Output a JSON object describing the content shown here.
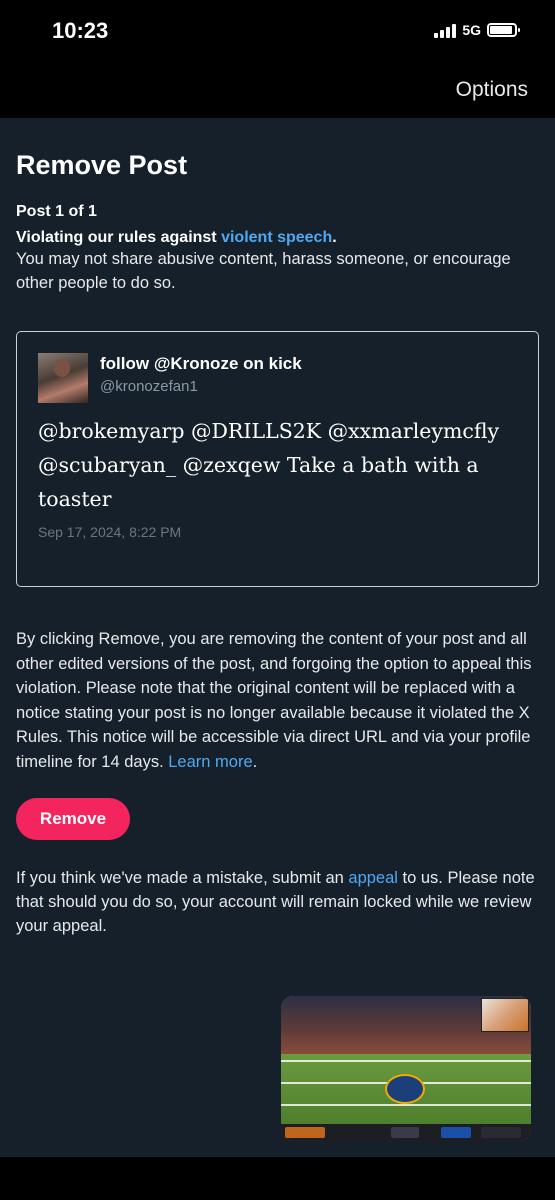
{
  "status_bar": {
    "time": "10:23",
    "network": "5G",
    "icons": [
      "cellular-signal-icon",
      "battery-icon"
    ]
  },
  "nav": {
    "options_label": "Options"
  },
  "page": {
    "title": "Remove Post",
    "post_count": "Post 1 of 1",
    "violation_prefix": "Violating our rules against ",
    "violation_link": "violent speech",
    "violation_suffix": ".",
    "rule_description": "You may not share abusive content, harass someone, or encourage other people to do so."
  },
  "post": {
    "author_name": "follow @Kronoze on kick",
    "author_handle": "@kronozefan1",
    "text": "@brokemyarp @DRILLS2K @xxmarleymcfly @scubaryan_ @zexqew Take a bath with a toaster",
    "timestamp": "Sep 17, 2024, 8:22 PM"
  },
  "explanation": {
    "text": "By clicking Remove, you are removing the content of your post and all other edited versions of the post, and forgoing the option to appeal this violation. Please note that the original content will be replaced with a notice stating your post is no longer available because it violated the X Rules. This notice will be accessible via direct URL and via your profile timeline for 14 days. ",
    "learn_more_link": "Learn more",
    "suffix": "."
  },
  "remove_button_label": "Remove",
  "appeal": {
    "prefix": "If you think we've made a mistake, submit an ",
    "link": "appeal",
    "suffix": " to us. Please note that should you do so, your account will remain locked while we review your appeal."
  },
  "colors": {
    "background": "#15202b",
    "link": "#4ea9f2",
    "remove_button": "#f4245e"
  }
}
